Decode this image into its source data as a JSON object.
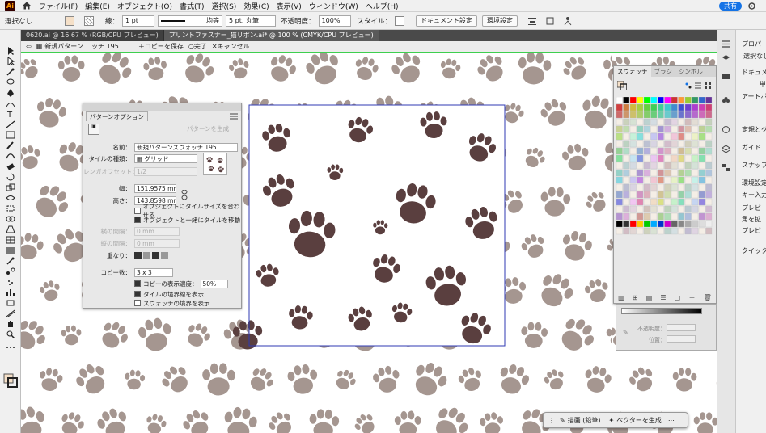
{
  "menubar": {
    "items": [
      "ファイル(F)",
      "編集(E)",
      "オブジェクト(O)",
      "書式(T)",
      "選択(S)",
      "効果(C)",
      "表示(V)",
      "ウィンドウ(W)",
      "ヘルプ(H)"
    ],
    "share_label": "共有"
  },
  "controlbar": {
    "selection": "選択なし",
    "stroke_label": "線：",
    "stroke_value": "1 pt",
    "line_style": "均等",
    "brush": "5 pt. 丸筆",
    "opacity_label": "不透明度：",
    "opacity_value": "100%",
    "style_label": "スタイル：",
    "doc_settings": "ドキュメント設定",
    "prefs": "環境設定"
  },
  "tabs": [
    {
      "label": "0620.ai @ 16.67 % (RGB/CPU プレビュー)",
      "active": false
    },
    {
      "label": "プリントファスナー_猫リボン.ai* @ 100 % (CMYK/CPU プレビュー)",
      "active": true
    }
  ],
  "patternbar": {
    "name": "新規パターン ...ッチ 195",
    "save_copy": "コピーを保存",
    "done": "完了",
    "cancel": "キャンセル"
  },
  "pattern_panel": {
    "tab": "パターンオプション",
    "generate": "パターンを生成",
    "name_label": "名前：",
    "name_value": "新規パターンスウォッチ 195",
    "tile_type_label": "タイルの種類：",
    "tile_type_value": "グリッド",
    "brick_offset_label": "レンガオフセット：",
    "brick_offset_value": "1/2",
    "width_label": "幅：",
    "width_value": "151.9575 mm",
    "height_label": "高さ：",
    "height_value": "143.8598 mm",
    "opt_fit_size": "オブジェクトにタイルサイズを合わせる",
    "opt_move_tile": "オブジェクトと一緒にタイルを移動",
    "h_spacing_label": "横の間隔：",
    "h_spacing_value": "0 mm",
    "v_spacing_label": "縦の間隔：",
    "v_spacing_value": "0 mm",
    "overlap_label": "重なり：",
    "copies_label": "コピー数：",
    "copies_value": "3 x 3",
    "dim_copies": "コピーの表示濃度：",
    "dim_value": "50%",
    "show_tile_edge": "タイルの境界線を表示",
    "show_swatch_bounds": "スウォッチの境界を表示"
  },
  "swatch_panel": {
    "tabs": [
      "スウォッチ",
      "ブラシ",
      "シンボル"
    ]
  },
  "grad_panel": {
    "opacity_label": "不透明度：",
    "position_label": "位置："
  },
  "right_dock": {
    "items": [
      "プロパ",
      "選択なし",
      "ドキュメ",
      "単",
      "アートボー",
      "定規とグ",
      "ガイド",
      "スナップ",
      "環境設定",
      "キー入力",
      "プレビ",
      "角を拡",
      "プレビ",
      "クイック"
    ]
  },
  "bottom_bar": {
    "draw": "描画 (鉛筆)",
    "vector": "ベクターを生成"
  },
  "colors": {
    "paw_bg": "#a59690",
    "paw_tile": "#5a3f3f",
    "accent": "#1473e6",
    "pattern_edge": "#3ecf4f"
  }
}
